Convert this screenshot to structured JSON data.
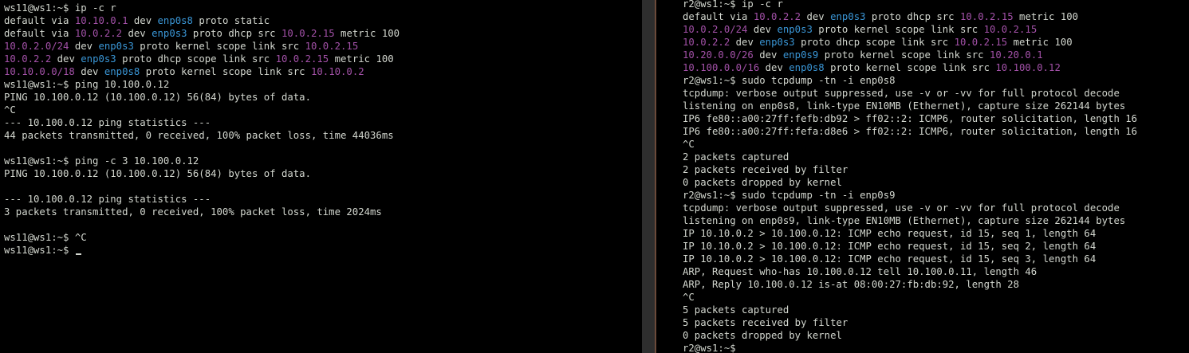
{
  "colors": {
    "background": "#000000",
    "text": "#d3d7cf",
    "ip": "#a351a8",
    "device": "#3a96d6"
  },
  "left_terminal": {
    "lines": [
      [
        {
          "t": "ws11@ws1:~$ ip -c r",
          "c": "default"
        }
      ],
      [
        {
          "t": "default via ",
          "c": "default"
        },
        {
          "t": "10.10.0.1",
          "c": "ip"
        },
        {
          "t": " dev ",
          "c": "default"
        },
        {
          "t": "enp0s8",
          "c": "dev"
        },
        {
          "t": " proto static",
          "c": "default"
        }
      ],
      [
        {
          "t": "default via ",
          "c": "default"
        },
        {
          "t": "10.0.2.2",
          "c": "ip"
        },
        {
          "t": " dev ",
          "c": "default"
        },
        {
          "t": "enp0s3",
          "c": "dev"
        },
        {
          "t": " proto dhcp src ",
          "c": "default"
        },
        {
          "t": "10.0.2.15",
          "c": "ip"
        },
        {
          "t": " metric 100",
          "c": "default"
        }
      ],
      [
        {
          "t": "10.0.2.0/24",
          "c": "ip"
        },
        {
          "t": " dev ",
          "c": "default"
        },
        {
          "t": "enp0s3",
          "c": "dev"
        },
        {
          "t": " proto kernel scope link src ",
          "c": "default"
        },
        {
          "t": "10.0.2.15",
          "c": "ip"
        }
      ],
      [
        {
          "t": "10.0.2.2",
          "c": "ip"
        },
        {
          "t": " dev ",
          "c": "default"
        },
        {
          "t": "enp0s3",
          "c": "dev"
        },
        {
          "t": " proto dhcp scope link src ",
          "c": "default"
        },
        {
          "t": "10.0.2.15",
          "c": "ip"
        },
        {
          "t": " metric 100",
          "c": "default"
        }
      ],
      [
        {
          "t": "10.10.0.0/18",
          "c": "ip"
        },
        {
          "t": " dev ",
          "c": "default"
        },
        {
          "t": "enp0s8",
          "c": "dev"
        },
        {
          "t": " proto kernel scope link src ",
          "c": "default"
        },
        {
          "t": "10.10.0.2",
          "c": "ip"
        }
      ],
      [
        {
          "t": "ws11@ws1:~$ ping 10.100.0.12",
          "c": "default"
        }
      ],
      [
        {
          "t": "PING 10.100.0.12 (10.100.0.12) 56(84) bytes of data.",
          "c": "default"
        }
      ],
      [
        {
          "t": "^C",
          "c": "default"
        }
      ],
      [
        {
          "t": "--- 10.100.0.12 ping statistics ---",
          "c": "default"
        }
      ],
      [
        {
          "t": "44 packets transmitted, 0 received, 100% packet loss, time 44036ms",
          "c": "default"
        }
      ],
      [
        {
          "t": "",
          "c": "default"
        }
      ],
      [
        {
          "t": "ws11@ws1:~$ ping -c 3 10.100.0.12",
          "c": "default"
        }
      ],
      [
        {
          "t": "PING 10.100.0.12 (10.100.0.12) 56(84) bytes of data.",
          "c": "default"
        }
      ],
      [
        {
          "t": "",
          "c": "default"
        }
      ],
      [
        {
          "t": "--- 10.100.0.12 ping statistics ---",
          "c": "default"
        }
      ],
      [
        {
          "t": "3 packets transmitted, 0 received, 100% packet loss, time 2024ms",
          "c": "default"
        }
      ],
      [
        {
          "t": "",
          "c": "default"
        }
      ],
      [
        {
          "t": "ws11@ws1:~$ ^C",
          "c": "default"
        }
      ],
      [
        {
          "t": "ws11@ws1:~$ ",
          "c": "default"
        }
      ]
    ]
  },
  "right_terminal": {
    "lines": [
      [
        {
          "t": "r2@ws1:~$ ip -c r",
          "c": "default"
        }
      ],
      [
        {
          "t": "default via ",
          "c": "default"
        },
        {
          "t": "10.0.2.2",
          "c": "ip"
        },
        {
          "t": " dev ",
          "c": "default"
        },
        {
          "t": "enp0s3",
          "c": "dev"
        },
        {
          "t": " proto dhcp src ",
          "c": "default"
        },
        {
          "t": "10.0.2.15",
          "c": "ip"
        },
        {
          "t": " metric 100",
          "c": "default"
        }
      ],
      [
        {
          "t": "10.0.2.0/24",
          "c": "ip"
        },
        {
          "t": " dev ",
          "c": "default"
        },
        {
          "t": "enp0s3",
          "c": "dev"
        },
        {
          "t": " proto kernel scope link src ",
          "c": "default"
        },
        {
          "t": "10.0.2.15",
          "c": "ip"
        }
      ],
      [
        {
          "t": "10.0.2.2",
          "c": "ip"
        },
        {
          "t": " dev ",
          "c": "default"
        },
        {
          "t": "enp0s3",
          "c": "dev"
        },
        {
          "t": " proto dhcp scope link src ",
          "c": "default"
        },
        {
          "t": "10.0.2.15",
          "c": "ip"
        },
        {
          "t": " metric 100",
          "c": "default"
        }
      ],
      [
        {
          "t": "10.20.0.0/26",
          "c": "ip"
        },
        {
          "t": " dev ",
          "c": "default"
        },
        {
          "t": "enp0s9",
          "c": "dev"
        },
        {
          "t": " proto kernel scope link src ",
          "c": "default"
        },
        {
          "t": "10.20.0.1",
          "c": "ip"
        }
      ],
      [
        {
          "t": "10.100.0.0/16",
          "c": "ip"
        },
        {
          "t": " dev ",
          "c": "default"
        },
        {
          "t": "enp0s8",
          "c": "dev"
        },
        {
          "t": " proto kernel scope link src ",
          "c": "default"
        },
        {
          "t": "10.100.0.12",
          "c": "ip"
        }
      ],
      [
        {
          "t": "r2@ws1:~$ sudo tcpdump -tn -i enp0s8",
          "c": "default"
        }
      ],
      [
        {
          "t": "tcpdump: verbose output suppressed, use -v or -vv for full protocol decode",
          "c": "default"
        }
      ],
      [
        {
          "t": "listening on enp0s8, link-type EN10MB (Ethernet), capture size 262144 bytes",
          "c": "default"
        }
      ],
      [
        {
          "t": "IP6 fe80::a00:27ff:fefb:db92 > ff02::2: ICMP6, router solicitation, length 16",
          "c": "default"
        }
      ],
      [
        {
          "t": "IP6 fe80::a00:27ff:fefa:d8e6 > ff02::2: ICMP6, router solicitation, length 16",
          "c": "default"
        }
      ],
      [
        {
          "t": "^C",
          "c": "default"
        }
      ],
      [
        {
          "t": "2 packets captured",
          "c": "default"
        }
      ],
      [
        {
          "t": "2 packets received by filter",
          "c": "default"
        }
      ],
      [
        {
          "t": "0 packets dropped by kernel",
          "c": "default"
        }
      ],
      [
        {
          "t": "r2@ws1:~$ sudo tcpdump -tn -i enp0s9",
          "c": "default"
        }
      ],
      [
        {
          "t": "tcpdump: verbose output suppressed, use -v or -vv for full protocol decode",
          "c": "default"
        }
      ],
      [
        {
          "t": "listening on enp0s9, link-type EN10MB (Ethernet), capture size 262144 bytes",
          "c": "default"
        }
      ],
      [
        {
          "t": "IP 10.10.0.2 > 10.100.0.12: ICMP echo request, id 15, seq 1, length 64",
          "c": "default"
        }
      ],
      [
        {
          "t": "IP 10.10.0.2 > 10.100.0.12: ICMP echo request, id 15, seq 2, length 64",
          "c": "default"
        }
      ],
      [
        {
          "t": "IP 10.10.0.2 > 10.100.0.12: ICMP echo request, id 15, seq 3, length 64",
          "c": "default"
        }
      ],
      [
        {
          "t": "ARP, Request who-has 10.100.0.12 tell 10.100.0.11, length 46",
          "c": "default"
        }
      ],
      [
        {
          "t": "ARP, Reply 10.100.0.12 is-at 08:00:27:fb:db:92, length 28",
          "c": "default"
        }
      ],
      [
        {
          "t": "^C",
          "c": "default"
        }
      ],
      [
        {
          "t": "5 packets captured",
          "c": "default"
        }
      ],
      [
        {
          "t": "5 packets received by filter",
          "c": "default"
        }
      ],
      [
        {
          "t": "0 packets dropped by kernel",
          "c": "default"
        }
      ],
      [
        {
          "t": "r2@ws1:~$",
          "c": "default"
        }
      ]
    ]
  }
}
